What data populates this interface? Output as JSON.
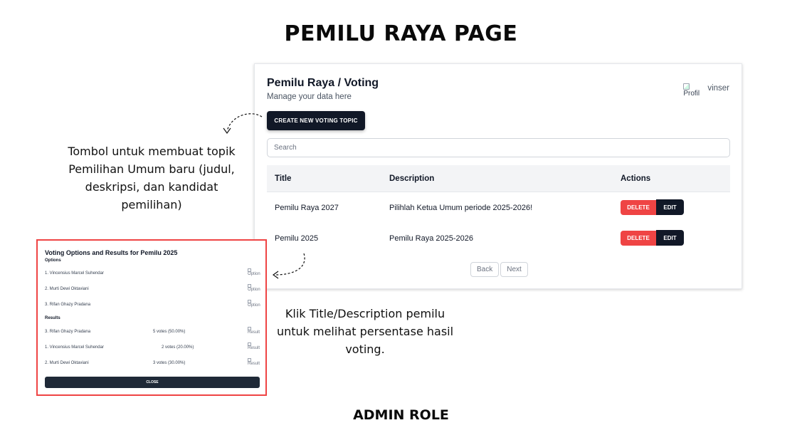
{
  "page_title": "PEMILU RAYA PAGE",
  "role_label": "ADMIN ROLE",
  "app": {
    "heading": "Pemilu Raya / Voting",
    "subheading": "Manage your data here",
    "profile": {
      "alt": "Profil",
      "username": "vinser"
    },
    "create_button": "CREATE NEW VOTING TOPIC",
    "search_placeholder": "Search",
    "columns": [
      "Title",
      "Description",
      "Actions"
    ],
    "rows": [
      {
        "title": "Pemilu Raya 2027",
        "description": "Pilihlah Ketua Umum periode 2025-2026!"
      },
      {
        "title": "Pemilu 2025",
        "description": "Pemilu Raya 2025-2026"
      }
    ],
    "delete_label": "DELETE",
    "edit_label": "EDIT",
    "pagination": {
      "back": "Back",
      "next": "Next"
    },
    "colors": {
      "primary": "#111827",
      "danger": "#ef4444",
      "highlight_border": "#ef4444"
    }
  },
  "annotations": {
    "create_note": "Tombol untuk membuat topik Pemilihan Umum baru (judul, deskripsi, dan kandidat pemilihan)",
    "detail_note": "Klik Title/Description pemilu untuk melihat persentase hasil voting."
  },
  "modal": {
    "title": "Voting Options and Results for Pemilu 2025",
    "options_heading": "Options",
    "options": [
      {
        "label": "1. Vincensius Marcel Suhendar",
        "img_alt": "Option"
      },
      {
        "label": "2. Murti Dewi Oktaviani",
        "img_alt": "Option"
      },
      {
        "label": "3. Rifan Ghazy Pradana",
        "img_alt": "Option"
      }
    ],
    "results_heading": "Results",
    "results": [
      {
        "label": "3. Rifan Ghazy Pradana",
        "votes": "5 votes (50.00%)",
        "img_alt": "Result"
      },
      {
        "label": "1. Vincensius Marcel Suhendar",
        "votes": "2 votes (20.00%)",
        "img_alt": "Result"
      },
      {
        "label": "2. Murti Dewi Oktaviani",
        "votes": "3 votes (30.00%)",
        "img_alt": "Result"
      }
    ],
    "close_label": "CLOSE"
  }
}
